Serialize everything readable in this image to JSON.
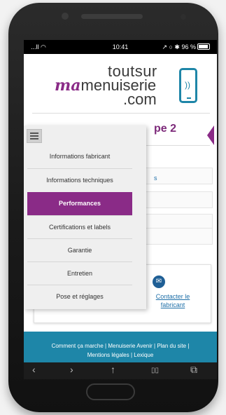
{
  "status_bar": {
    "signal": "...ll ◠",
    "time": "10:41",
    "right": "↗ ○ ✱ 96 %"
  },
  "logo": {
    "line1": "toutsur",
    "ma": "ma",
    "line2": "menuiserie",
    "line3": ".com"
  },
  "page": {
    "title_fragment": "pe 2",
    "background_link": "s"
  },
  "menu": {
    "items": [
      {
        "label": "Informations fabricant"
      },
      {
        "label": "Informations techniques"
      },
      {
        "label": "Performances",
        "active": true
      },
      {
        "label": "Certifications et labels"
      },
      {
        "label": "Garantie"
      },
      {
        "label": "Entretien"
      },
      {
        "label": "Pose et réglages"
      }
    ]
  },
  "contact": {
    "label": "Contacter le fabricant"
  },
  "footer": {
    "line1": "Comment ça marche | Menuiserie Avenir | Plan du site |",
    "line2": "Mentions légales | Lexique"
  },
  "toolbar": {
    "back": "‹",
    "forward": "›",
    "share": "↑",
    "bookmarks": "▯▯",
    "tabs": "⧉"
  },
  "colors": {
    "brand_purple": "#8a2b87",
    "brand_blue": "#1e86a8",
    "link": "#1e6fa8"
  }
}
